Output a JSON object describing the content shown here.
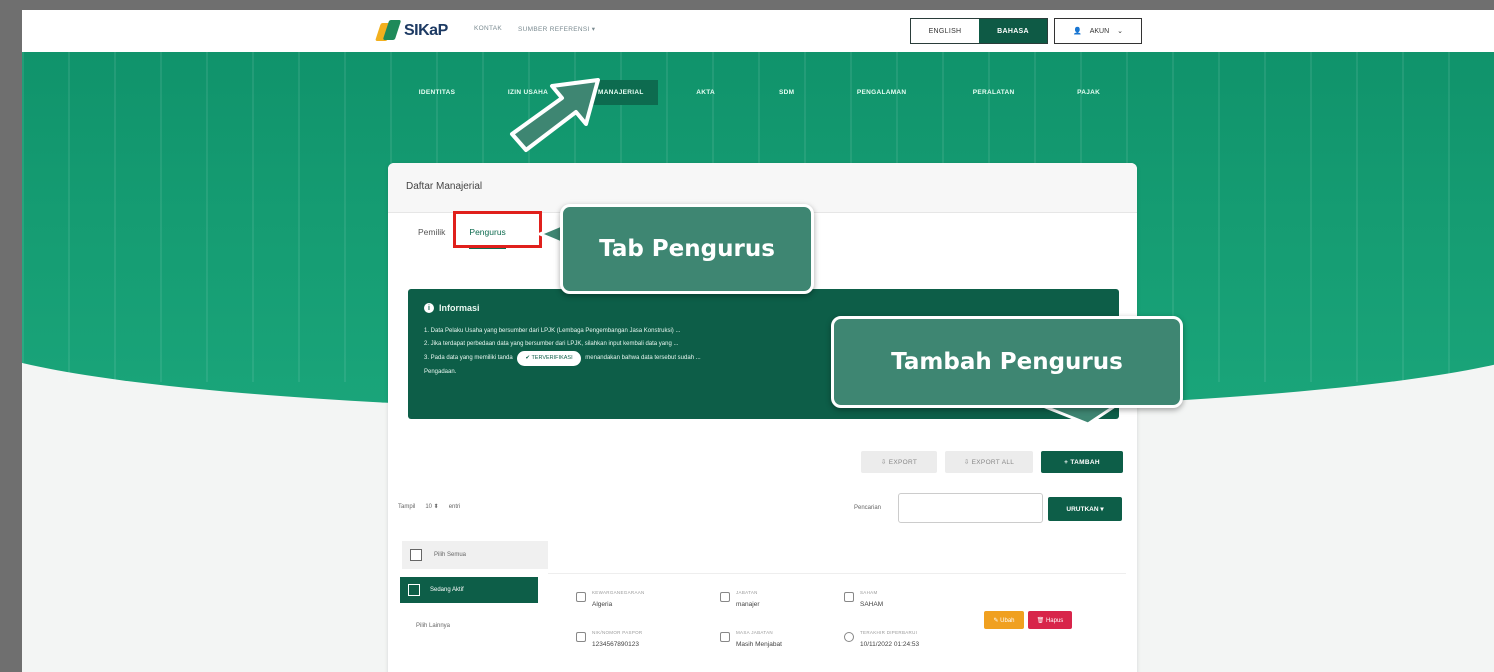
{
  "app": {
    "logo_text": "SIKaP"
  },
  "topnav": {
    "items": [
      "KONTAK",
      "SUMBER REFERENSI ▾"
    ]
  },
  "language": {
    "english": "ENGLISH",
    "bahasa": "BAHASA"
  },
  "account": {
    "label": "AKUN"
  },
  "mainnav": {
    "items": [
      "IDENTITAS",
      "IZIN USAHA",
      "MANAJERIAL",
      "AKTA",
      "SDM",
      "PENGALAMAN",
      "PERALATAN",
      "PAJAK"
    ],
    "active_index": 2
  },
  "card": {
    "title": "Daftar Manajerial",
    "tabs": [
      "Pemilik",
      "Pengurus"
    ],
    "active_tab": "Pengurus"
  },
  "info": {
    "title": "Informasi",
    "line1": "1. Data Pelaku Usaha yang bersumber dari LPJK (Lembaga Pengembangan Jasa Konstruksi) ...",
    "line2": "2. Jika terdapat perbedaan data yang bersumber dari LPJK, silahkan input kembali data yang ...",
    "line3_pre": "3. Pada data yang memiliki tanda",
    "line3_badge": "✔ TERVERIFIKASI",
    "line3_post": "menandakan bahwa data tersebut sudah ...",
    "line4": "Pengadaan."
  },
  "buttons": {
    "export": "⇩ EXPORT",
    "export_all": "⇩ EXPORT ALL",
    "tambah": "+ TAMBAH",
    "urutkan": "URUTKAN ▾"
  },
  "table_controls": {
    "show_label": "Tampil",
    "show_value": "10 ⬍",
    "entries_label": "entri",
    "search_label": "Pencarian"
  },
  "filters": {
    "all": "Pilih Semua",
    "active": "Sedang Aktif",
    "other": "Pilih Lainnya"
  },
  "row": {
    "f1_label": "KEWARGANEGARAAN",
    "f1_value": "Algeria",
    "f2_label": "JABATAN",
    "f2_value": "manajer",
    "f3_label": "SAHAM",
    "f3_value": "SAHAM",
    "f4_label": "NIK/NOMOR PASPOR",
    "f4_value": "1234567890123",
    "f5_label": "MASA JABATAN",
    "f5_value": "Masih Menjabat",
    "f6_label": "TERAKHIR DIPERBARUI",
    "f6_value": "10/11/2022 01:24:53",
    "edit": "✎ Ubah",
    "delete": "🗑 Hapus"
  },
  "callouts": {
    "tab": "Tab Pengurus",
    "tambah": "Tambah Pengurus"
  },
  "colors": {
    "brand_green": "#0d5e48",
    "hero_green": "#159c72",
    "callout": "#3e8672",
    "highlight_red": "#e0201c"
  }
}
